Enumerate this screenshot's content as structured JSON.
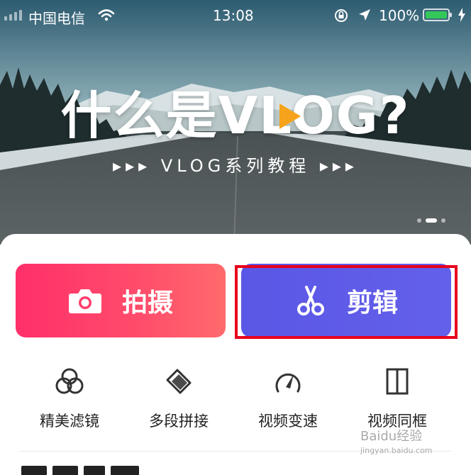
{
  "status_bar": {
    "carrier": "中国电信",
    "time": "13:08",
    "battery_percent": "100%",
    "battery_level": 1.0
  },
  "banner": {
    "title": "什么是VLOG?",
    "subtitle": "▸▸▸ VLOG系列教程 ▸▸▸",
    "page_count": 3,
    "active_page": 2
  },
  "actions": {
    "shoot_label": "拍摄",
    "edit_label": "剪辑"
  },
  "tools": [
    {
      "label": "精美滤镜",
      "icon": "filter-circles-icon"
    },
    {
      "label": "多段拼接",
      "icon": "layers-icon"
    },
    {
      "label": "视频变速",
      "icon": "speed-gauge-icon"
    },
    {
      "label": "视频同框",
      "icon": "split-frame-icon"
    }
  ],
  "watermark": {
    "brand": "Baidu经验",
    "url": "jingyan.baidu.com"
  },
  "colors": {
    "shoot_gradient_start": "#ff2f6a",
    "shoot_gradient_end": "#ff6a6c",
    "edit_color": "#5b57e6",
    "highlight_border": "#e8001c",
    "play_accent": "#f6a21a"
  }
}
